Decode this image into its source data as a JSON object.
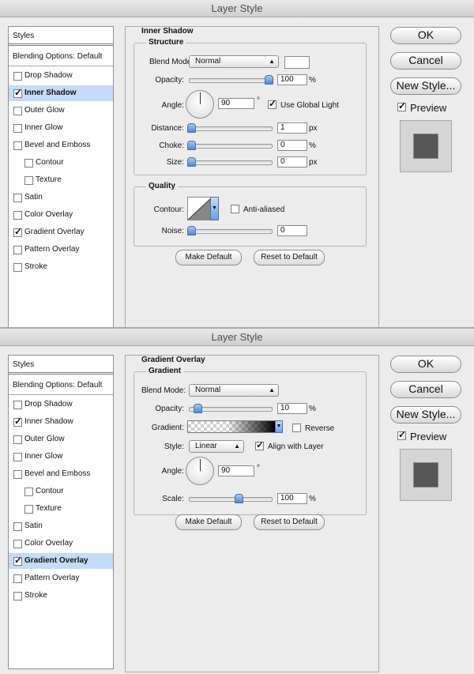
{
  "dialogs": [
    {
      "title": "Layer Style",
      "sidebar": {
        "styles_label": "Styles",
        "blending_label": "Blending Options: Default",
        "items": [
          {
            "label": "Drop Shadow",
            "checked": false,
            "selected": false,
            "indent": false
          },
          {
            "label": "Inner Shadow",
            "checked": true,
            "selected": true,
            "indent": false
          },
          {
            "label": "Outer Glow",
            "checked": false,
            "selected": false,
            "indent": false
          },
          {
            "label": "Inner Glow",
            "checked": false,
            "selected": false,
            "indent": false
          },
          {
            "label": "Bevel and Emboss",
            "checked": false,
            "selected": false,
            "indent": false
          },
          {
            "label": "Contour",
            "checked": false,
            "selected": false,
            "indent": true
          },
          {
            "label": "Texture",
            "checked": false,
            "selected": false,
            "indent": true
          },
          {
            "label": "Satin",
            "checked": false,
            "selected": false,
            "indent": false
          },
          {
            "label": "Color Overlay",
            "checked": false,
            "selected": false,
            "indent": false
          },
          {
            "label": "Gradient Overlay",
            "checked": true,
            "selected": false,
            "indent": false
          },
          {
            "label": "Pattern Overlay",
            "checked": false,
            "selected": false,
            "indent": false
          },
          {
            "label": "Stroke",
            "checked": false,
            "selected": false,
            "indent": false
          }
        ]
      },
      "section": "Inner Shadow",
      "structure": {
        "title": "Structure",
        "blend_mode_label": "Blend Mode:",
        "blend_mode": "Normal",
        "opacity_label": "Opacity:",
        "opacity": "100",
        "percent": "%",
        "angle_label": "Angle:",
        "angle": "90",
        "degree": "°",
        "use_global_light": "Use Global Light",
        "use_global_light_checked": true,
        "distance_label": "Distance:",
        "distance": "1",
        "choke_label": "Choke:",
        "choke": "0",
        "size_label": "Size:",
        "size": "0",
        "px": "px"
      },
      "quality": {
        "title": "Quality",
        "contour_label": "Contour:",
        "anti_aliased": "Anti-aliased",
        "anti_aliased_checked": false,
        "noise_label": "Noise:",
        "noise": "0"
      },
      "make_default": "Make Default",
      "reset_default": "Reset to Default",
      "buttons": {
        "ok": "OK",
        "cancel": "Cancel",
        "new_style": "New Style...",
        "preview": "Preview"
      },
      "preview_checked": true
    },
    {
      "title": "Layer Style",
      "sidebar": {
        "styles_label": "Styles",
        "blending_label": "Blending Options: Default",
        "items": [
          {
            "label": "Drop Shadow",
            "checked": false,
            "selected": false,
            "indent": false
          },
          {
            "label": "Inner Shadow",
            "checked": true,
            "selected": false,
            "indent": false
          },
          {
            "label": "Outer Glow",
            "checked": false,
            "selected": false,
            "indent": false
          },
          {
            "label": "Inner Glow",
            "checked": false,
            "selected": false,
            "indent": false
          },
          {
            "label": "Bevel and Emboss",
            "checked": false,
            "selected": false,
            "indent": false
          },
          {
            "label": "Contour",
            "checked": false,
            "selected": false,
            "indent": true
          },
          {
            "label": "Texture",
            "checked": false,
            "selected": false,
            "indent": true
          },
          {
            "label": "Satin",
            "checked": false,
            "selected": false,
            "indent": false
          },
          {
            "label": "Color Overlay",
            "checked": false,
            "selected": false,
            "indent": false
          },
          {
            "label": "Gradient Overlay",
            "checked": true,
            "selected": true,
            "indent": false
          },
          {
            "label": "Pattern Overlay",
            "checked": false,
            "selected": false,
            "indent": false
          },
          {
            "label": "Stroke",
            "checked": false,
            "selected": false,
            "indent": false
          }
        ]
      },
      "section": "Gradient Overlay",
      "gradient": {
        "title": "Gradient",
        "blend_mode_label": "Blend Mode:",
        "blend_mode": "Normal",
        "opacity_label": "Opacity:",
        "opacity": "10",
        "percent": "%",
        "gradient_label": "Gradient:",
        "reverse": "Reverse",
        "reverse_checked": false,
        "style_label": "Style:",
        "style": "Linear",
        "align_with_layer": "Align with Layer",
        "align_checked": true,
        "angle_label": "Angle:",
        "angle": "90",
        "degree": "°",
        "scale_label": "Scale:",
        "scale": "100"
      },
      "make_default": "Make Default",
      "reset_default": "Reset to Default",
      "buttons": {
        "ok": "OK",
        "cancel": "Cancel",
        "new_style": "New Style...",
        "preview": "Preview"
      },
      "preview_checked": true
    }
  ]
}
